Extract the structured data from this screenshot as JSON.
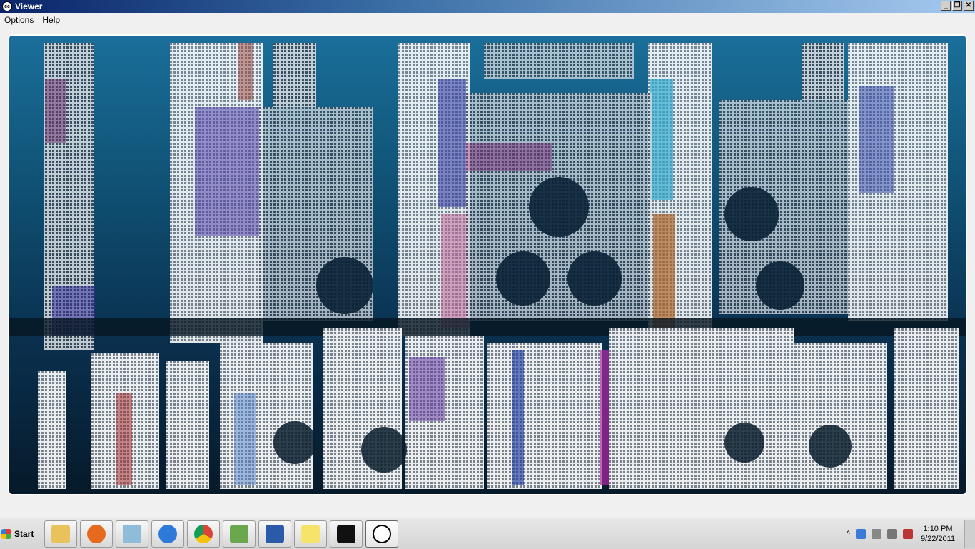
{
  "window": {
    "title": "Viewer",
    "app_icon_text": "cc"
  },
  "window_controls": {
    "minimize": "_",
    "restore": "❐",
    "close": "✕"
  },
  "menu": {
    "items": [
      "Options",
      "Help"
    ]
  },
  "viewport": {
    "content": "point-cloud-facade"
  },
  "taskbar": {
    "start_label": "Start",
    "pinned_icons": [
      "explorer-icon",
      "firefox-icon",
      "eraser-icon",
      "internet-explorer-icon",
      "chrome-icon",
      "chart-app-icon",
      "word-icon",
      "sticky-notes-icon",
      "terminal-icon",
      "cloudcompare-icon"
    ],
    "tray_expand": "^",
    "clock": {
      "time": "1:10 PM",
      "date": "9/22/2011"
    }
  },
  "colors": {
    "titlebar_start": "#0a246a",
    "titlebar_end": "#a6caf0",
    "viewport_top": "#1a6f9a",
    "viewport_bottom": "#061a2a"
  }
}
